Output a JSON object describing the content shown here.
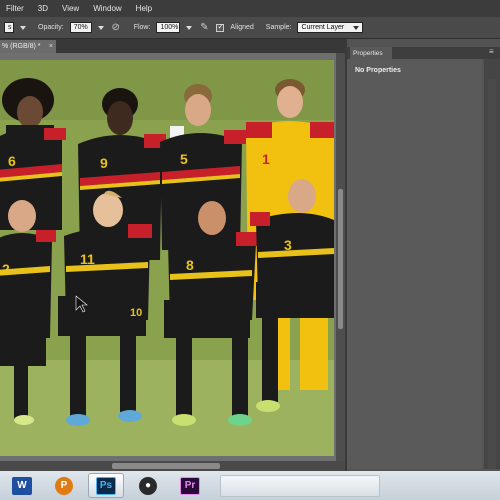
{
  "menubar": {
    "items": [
      "Filter",
      "3D",
      "View",
      "Window",
      "Help"
    ]
  },
  "options": {
    "mode_value": "s",
    "opacity_label": "Opacity:",
    "opacity_value": "70%",
    "flow_label": "Flow:",
    "flow_value": "100%",
    "aligned_label": "Aligned",
    "aligned_checked": true,
    "sample_label": "Sample:",
    "sample_value": "Current Layer"
  },
  "document": {
    "tab_label": "% (RGB/8) *",
    "close_glyph": "×"
  },
  "photo": {
    "jersey_numbers": [
      "6",
      "9",
      "5",
      "1",
      "2",
      "11",
      "8",
      "3",
      "10"
    ]
  },
  "properties_panel": {
    "tab_label": "Properties",
    "body_text": "No Properties",
    "menu_glyph": "≡"
  },
  "taskbar": {
    "apps": [
      {
        "name": "word",
        "glyph": "W"
      },
      {
        "name": "powerpoint",
        "glyph": "P"
      },
      {
        "name": "photoshop",
        "glyph": "Ps"
      },
      {
        "name": "obs",
        "glyph": "●"
      },
      {
        "name": "premiere",
        "glyph": "Pr"
      }
    ]
  },
  "colors": {
    "jersey_black": "#1b1b1b",
    "jersey_red": "#c8202a",
    "jersey_gold": "#e8c21a",
    "keeper_yellow": "#f2c10f",
    "pitch_green": "#8aa24d"
  }
}
